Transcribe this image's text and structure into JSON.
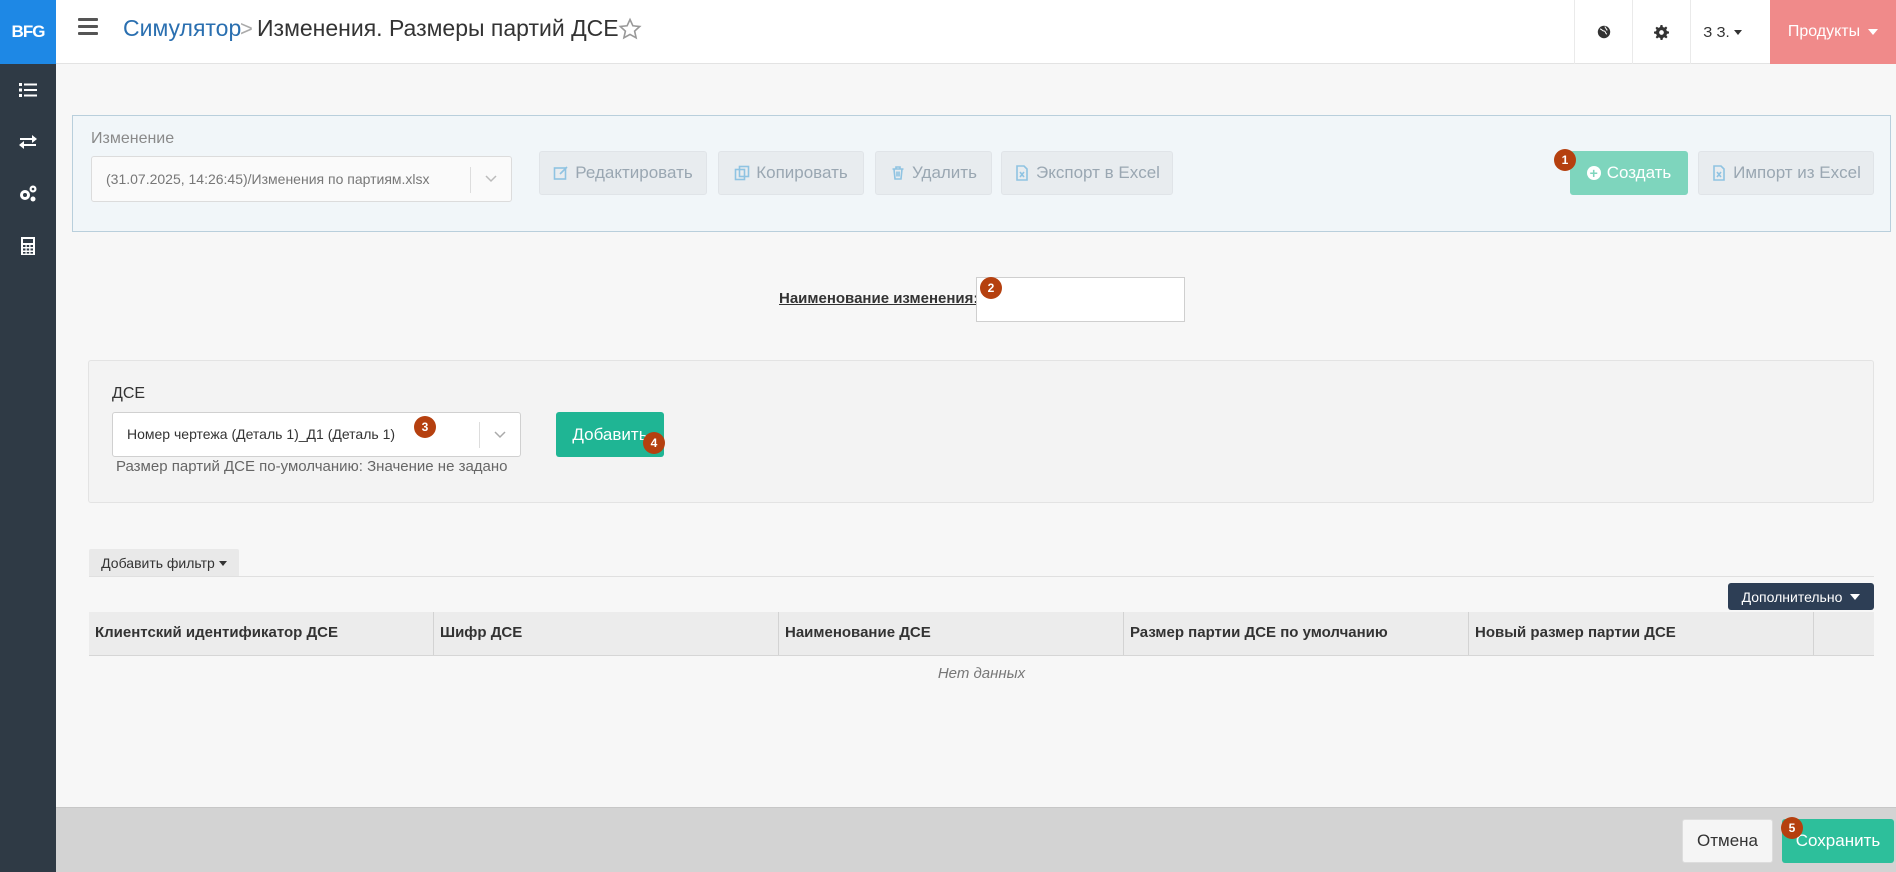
{
  "sidebar": {
    "logo": "BFG",
    "items": [
      {
        "icon": "list-icon"
      },
      {
        "icon": "transfer-icon"
      },
      {
        "icon": "gears-icon"
      },
      {
        "icon": "calculator-icon"
      }
    ]
  },
  "header": {
    "breadcrumb_link": "Симулятор",
    "breadcrumb_sep": ">",
    "title": "Изменения. Размеры партий ДСЕ",
    "user": "З З.",
    "products_label": "Продукты"
  },
  "toolbar": {
    "change_label": "Изменение",
    "change_value": "(31.07.2025, 14:26:45)/Изменения по партиям.xlsx",
    "edit_label": "Редактировать",
    "copy_label": "Копировать",
    "delete_label": "Удалить",
    "export_label": "Экспорт в Excel",
    "create_label": "Создать",
    "import_label": "Импорт из Excel"
  },
  "form": {
    "name_label": "Наименование изменения:",
    "name_value": ""
  },
  "dse": {
    "label": "ДСЕ",
    "selected": "Номер чертежа (Деталь 1)_Д1 (Деталь 1)",
    "hint": "Размер партий ДСЕ по-умолчанию: Значение не задано",
    "add_label": "Добавить"
  },
  "table": {
    "filter_label": "Добавить фильтр",
    "more_label": "Дополнительно",
    "columns": [
      "Клиентский идентификатор ДСЕ",
      "Шифр ДСЕ",
      "Наименование ДСЕ",
      "Размер партии ДСЕ по умолчанию",
      "Новый размер партии ДСЕ"
    ],
    "empty_text": "Нет данных"
  },
  "footer": {
    "cancel_label": "Отмена",
    "save_label": "Сохранить"
  },
  "badges": [
    "1",
    "2",
    "3",
    "4",
    "5"
  ],
  "colors": {
    "sidebar": "#2f3a45",
    "logo": "#1e88e5",
    "products": "#f08a8a",
    "primary": "#1fb594",
    "badge": "#b5400f"
  }
}
